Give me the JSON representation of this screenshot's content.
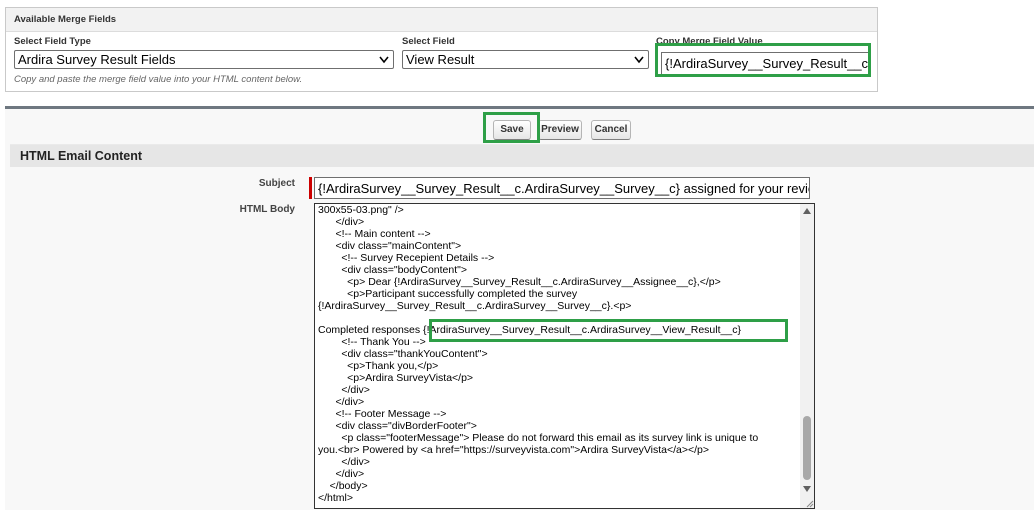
{
  "merge_panel": {
    "title": "Available Merge Fields",
    "field_type_label": "Select Field Type",
    "field_type_value": "Ardira Survey Result Fields",
    "field_label": "Select Field",
    "field_value": "View Result",
    "copy_label": "Copy Merge Field Value",
    "copy_value": "{!ArdiraSurvey__Survey_Result__c.ArdiraSurvey__View_Result__c}",
    "helper_text": "Copy and paste the merge field value into your HTML content below."
  },
  "buttons": {
    "save": "Save",
    "preview": "Preview",
    "cancel": "Cancel"
  },
  "section": {
    "title": "HTML Email Content"
  },
  "subject": {
    "label": "Subject",
    "value": "{!ArdiraSurvey__Survey_Result__c.ArdiraSurvey__Survey__c} assigned for your review"
  },
  "body": {
    "label": "HTML Body",
    "lines": [
      "300x55-03.png\" />",
      "      </div>",
      "      <!-- Main content -->",
      "      <div class=\"mainContent\">",
      "        <!-- Survey Recepient Details -->",
      "        <div class=\"bodyContent\">",
      "          <p> Dear {!ArdiraSurvey__Survey_Result__c.ArdiraSurvey__Assignee__c},</p>",
      "          <p>Participant successfully completed the survey",
      "{!ArdiraSurvey__Survey_Result__c.ArdiraSurvey__Survey__c}.<p>",
      "",
      "Completed responses {!ArdiraSurvey__Survey_Result__c.ArdiraSurvey__View_Result__c}",
      "        <!-- Thank You -->",
      "        <div class=\"thankYouContent\">",
      "          <p>Thank you,</p>",
      "          <p>Ardira SurveyVista</p>",
      "        </div>",
      "      </div>",
      "      <!-- Footer Message -->",
      "      <div class=\"divBorderFooter\">",
      "        <p class=\"footerMessage\"> Please do not forward this email as its survey link is unique to",
      "you.<br> Powered by <a href=\"https://surveyvista.com\">Ardira SurveyVista</a></p>",
      "        </div>",
      "      </div>",
      "    </body>",
      "</html>"
    ]
  },
  "colors": {
    "highlight": "#2e9f47",
    "required": "#cc0000",
    "section_header_bg": "#e6e6e6"
  },
  "icons": {
    "dropdown": "chevron-down-icon",
    "scroll_up": "triangle-up-icon",
    "scroll_down": "triangle-down-icon",
    "resize": "resize-grip-icon"
  }
}
